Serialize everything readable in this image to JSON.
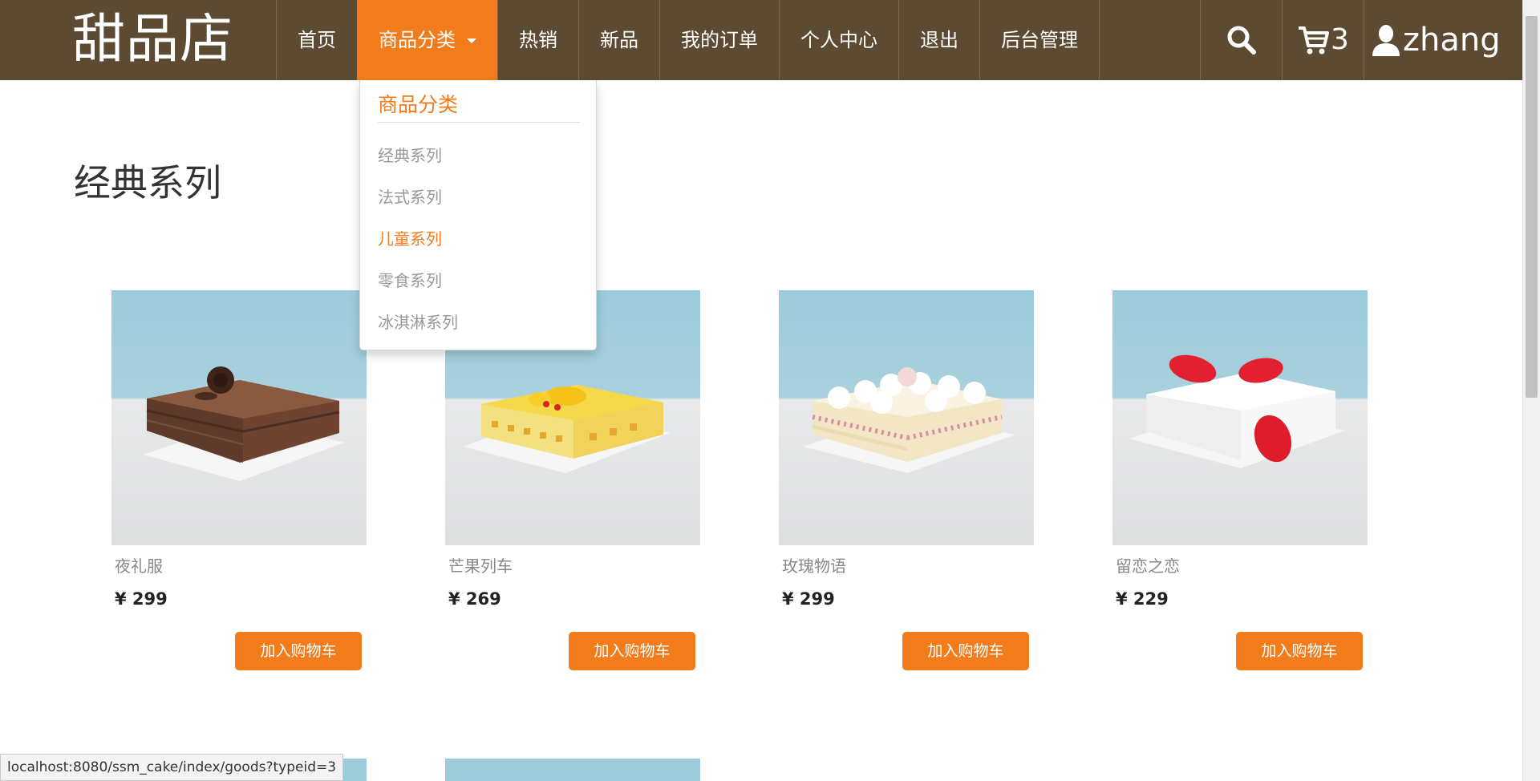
{
  "header": {
    "logo": "甜品店",
    "nav": [
      {
        "label": "首页"
      },
      {
        "label": "商品分类"
      },
      {
        "label": "热销"
      },
      {
        "label": "新品"
      },
      {
        "label": "我的订单"
      },
      {
        "label": "个人中心"
      },
      {
        "label": "退出"
      },
      {
        "label": "后台管理"
      }
    ],
    "cart_count": "3",
    "username": "zhang",
    "icons": {
      "search": "search-icon",
      "cart": "cart-icon",
      "user": "user-icon"
    }
  },
  "dropdown": {
    "title": "商品分类",
    "items": [
      {
        "label": "经典系列"
      },
      {
        "label": "法式系列"
      },
      {
        "label": "儿童系列"
      },
      {
        "label": "零食系列"
      },
      {
        "label": "冰淇淋系列"
      }
    ],
    "highlighted": "儿童系列"
  },
  "main": {
    "section_title": "经典系列",
    "products": [
      {
        "name": "夜礼服",
        "price": "¥ 299",
        "button": "加入购物车"
      },
      {
        "name": "芒果列车",
        "price": "¥ 269",
        "button": "加入购物车"
      },
      {
        "name": "玫瑰物语",
        "price": "¥ 299",
        "button": "加入购物车"
      },
      {
        "name": "留恋之恋",
        "price": "¥ 229",
        "button": "加入购物车"
      }
    ]
  },
  "status_bar": {
    "url": "localhost:8080/ssm_cake/index/goods?typeid=3"
  },
  "colors": {
    "header_bg": "#5c4a33",
    "accent": "#f27c1c",
    "muted_text": "#999999"
  }
}
